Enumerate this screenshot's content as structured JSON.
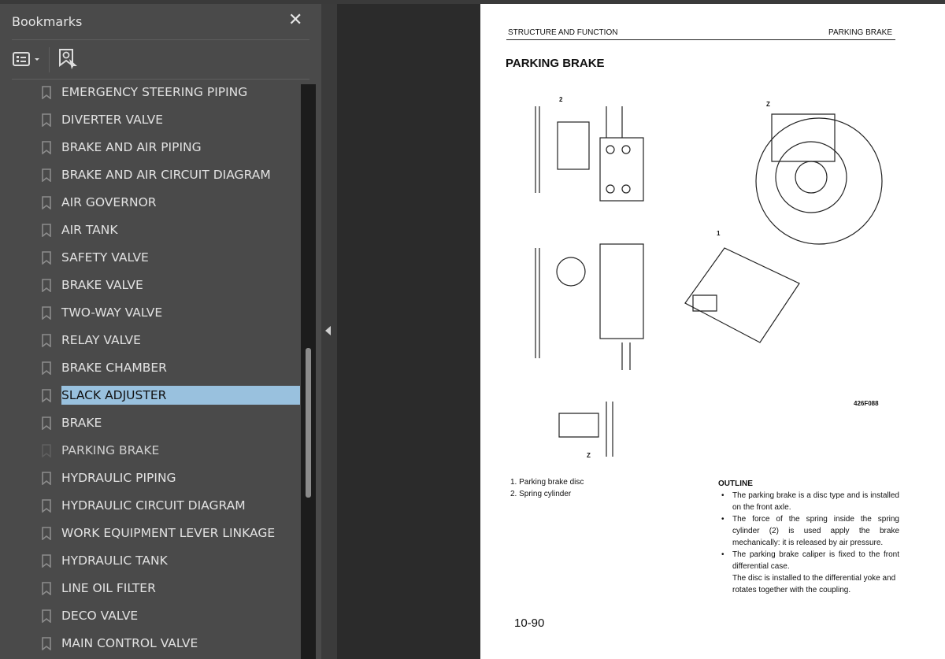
{
  "panel": {
    "title": "Bookmarks",
    "close_icon": "close-icon",
    "options_icon": "list-options-icon",
    "find_icon": "find-bookmark-icon"
  },
  "bookmarks": [
    {
      "label": "EMERGENCY STEERING PIPING"
    },
    {
      "label": "DIVERTER VALVE"
    },
    {
      "label": "BRAKE AND AIR PIPING"
    },
    {
      "label": "BRAKE AND AIR CIRCUIT DIAGRAM"
    },
    {
      "label": "AIR GOVERNOR"
    },
    {
      "label": "AIR TANK"
    },
    {
      "label": "SAFETY VALVE"
    },
    {
      "label": "BRAKE VALVE"
    },
    {
      "label": "TWO-WAY VALVE"
    },
    {
      "label": "RELAY VALVE"
    },
    {
      "label": "BRAKE CHAMBER"
    },
    {
      "label": "SLACK ADJUSTER",
      "selected": true
    },
    {
      "label": "BRAKE"
    },
    {
      "label": "PARKING BRAKE",
      "current": true
    },
    {
      "label": "HYDRAULIC PIPING"
    },
    {
      "label": "HYDRAULIC CIRCUIT DIAGRAM"
    },
    {
      "label": "WORK EQUIPMENT LEVER LINKAGE"
    },
    {
      "label": "HYDRAULIC TANK"
    },
    {
      "label": "LINE OIL FILTER"
    },
    {
      "label": "DECO VALVE"
    },
    {
      "label": "MAIN CONTROL VALVE"
    }
  ],
  "colors": {
    "selection": "#99c1de",
    "panel": "#4a4a4a",
    "background": "#2b2b2b"
  },
  "document": {
    "header_left": "STRUCTURE AND FUNCTION",
    "header_right": "PARKING BRAKE",
    "title": "PARKING BRAKE",
    "figure_labels": {
      "callout_2": "2",
      "callout_z": "Z",
      "callout_1": "1",
      "view_z": "Z",
      "figure_code": "426F088"
    },
    "parts": [
      "1. Parking brake disc",
      "2. Spring cylinder"
    ],
    "outline": {
      "heading": "OUTLINE",
      "bullets": [
        "The parking brake is a disc type and is installed on the front axle.",
        "The force of the spring inside the spring cylinder (2) is used apply the brake mechanically: it is released by air pressure.",
        "The parking brake caliper is fixed to the front differential case."
      ],
      "continuation": "The disc is installed to the differential yoke and rotates together with the coupling."
    },
    "page_number": "10-90"
  }
}
